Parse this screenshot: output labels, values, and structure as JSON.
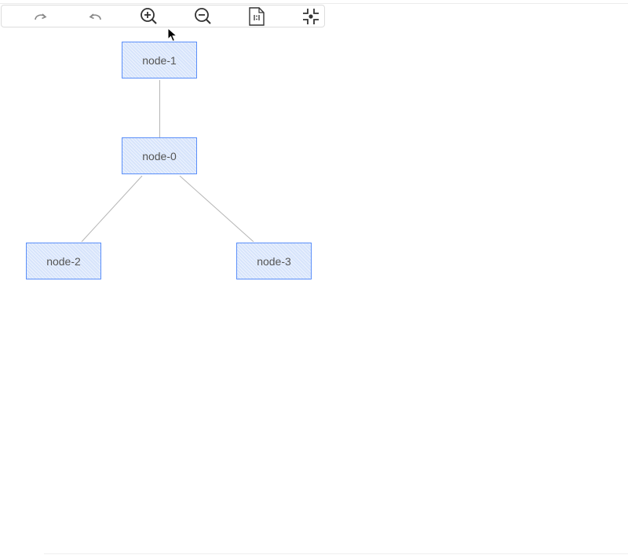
{
  "toolbar": {
    "tools": [
      {
        "name": "redo",
        "icon": "redo-icon"
      },
      {
        "name": "undo",
        "icon": "undo-icon"
      },
      {
        "name": "zoom-in",
        "icon": "zoom-in-icon"
      },
      {
        "name": "zoom-out",
        "icon": "zoom-out-icon"
      },
      {
        "name": "actual-size",
        "icon": "actual-size-icon",
        "glyph": "1:1"
      },
      {
        "name": "fit-view",
        "icon": "fit-view-icon"
      }
    ]
  },
  "graph": {
    "nodes": [
      {
        "id": "node-0",
        "label": "node-0"
      },
      {
        "id": "node-1",
        "label": "node-1"
      },
      {
        "id": "node-2",
        "label": "node-2"
      },
      {
        "id": "node-3",
        "label": "node-3"
      }
    ],
    "edges": [
      {
        "source": "node-0",
        "target": "node-1"
      },
      {
        "source": "node-0",
        "target": "node-2"
      },
      {
        "source": "node-0",
        "target": "node-3"
      }
    ]
  },
  "colors": {
    "node_fill": "#d7e4fb",
    "node_stroke": "#5b8ff9",
    "edge": "#b5b5b5",
    "icon": "#333333"
  }
}
